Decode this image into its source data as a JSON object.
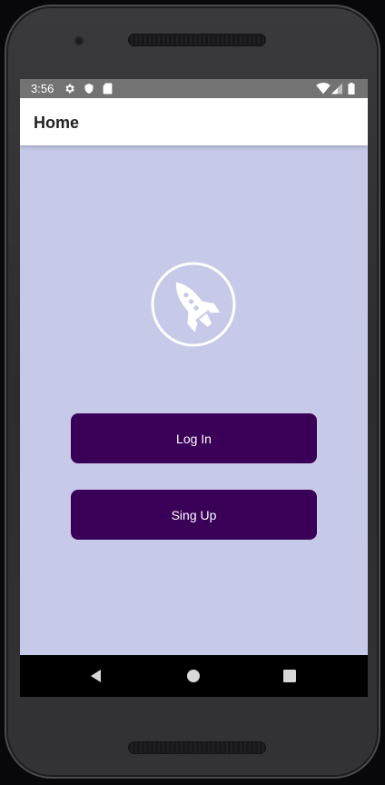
{
  "status_bar": {
    "time": "3:56",
    "left_icons": [
      "gear-icon",
      "shield-icon",
      "sd-card-icon"
    ],
    "right_icons": [
      "wifi-icon",
      "cell-signal-icon",
      "battery-icon"
    ]
  },
  "app_bar": {
    "title": "Home"
  },
  "main": {
    "logo_icon": "rocket-icon",
    "login_label": "Log In",
    "signup_label": "Sing Up"
  },
  "nav_bar": {
    "buttons": [
      "back-icon",
      "home-icon",
      "recents-icon"
    ]
  },
  "colors": {
    "background": "#c6cae8",
    "button": "#3a0058",
    "status_bar": "#737373",
    "app_bar": "#ffffff"
  }
}
